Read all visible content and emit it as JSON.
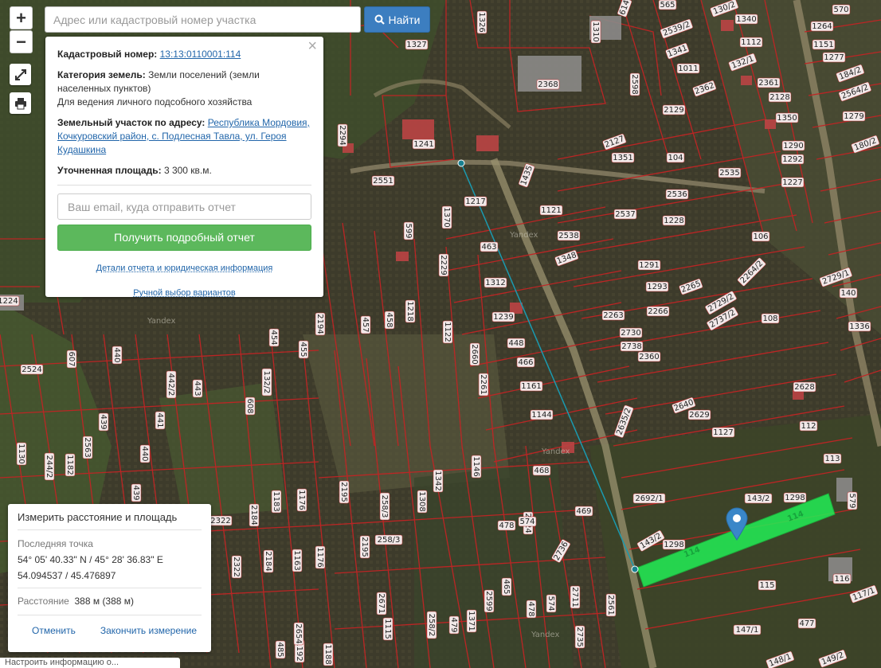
{
  "search": {
    "placeholder": "Адрес или кадастровый номер участка",
    "button_label": "Найти"
  },
  "map_controls": {
    "zoom_in": "+",
    "zoom_out": "−"
  },
  "popup": {
    "cadastral_label": "Кадастровый номер:",
    "cadastral_value": "13:13:0110001:114",
    "category_label": "Категория земель:",
    "category_value": "Земли поселений (земли населенных пунктов)",
    "usage": "Для ведения личного подсобного хозяйства",
    "address_label": "Земельный участок по адресу:",
    "address_value": "Республика Мордовия, Кочкуровский район, с. Подлесная Тавла, ул. Героя Кудашкина",
    "area_label": "Уточненная площадь:",
    "area_value": "3 300 кв.м.",
    "email_placeholder": "Ваш email, куда отправить отчет",
    "report_button": "Получить подробный отчет",
    "details_link": "Детали отчета и юридическая информация",
    "manual_link": "Ручной выбор вариантов"
  },
  "measure": {
    "title": "Измерить расстояние и площадь",
    "last_point_label": "Последняя точка",
    "dms": "54° 05' 40.33\" N / 45° 28' 36.83\" E",
    "decimal": "54.094537 / 45.476897",
    "distance_label": "Расстояние",
    "distance_value": "388 м (388 м)",
    "cancel": "Отменить",
    "finish": "Закончить измерение"
  },
  "bottom_bar": {
    "text": "Настроить информацию о..."
  },
  "map": {
    "selected_parcel_label": "114",
    "watermark": "Yandex",
    "parcel_labels": [
      "1326",
      "614",
      "565",
      "130/2",
      "1340",
      "570",
      "1264",
      "1310",
      "1327",
      "2539/2",
      "1112",
      "1151",
      "1341",
      "1277",
      "184/2",
      "1011",
      "132/1",
      "2368",
      "2362",
      "2361",
      "2564/2",
      "2598",
      "2129",
      "2128",
      "1350",
      "1279",
      "1241",
      "2127",
      "1290",
      "180/2",
      "1351",
      "104",
      "1292",
      "2294",
      "2535",
      "1227",
      "2551",
      "1435",
      "1217",
      "2536",
      "1370",
      "1121",
      "2537",
      "1228",
      "599",
      "2538",
      "106",
      "463",
      "1348",
      "1291",
      "2264/2",
      "2729/1",
      "1312",
      "1293",
      "2265",
      "140",
      "2229",
      "2263",
      "2729/2",
      "1218",
      "2266",
      "2737/2",
      "108",
      "1336",
      "1239",
      "457",
      "458",
      "2730",
      "454",
      "455",
      "2194",
      "1122",
      "448",
      "2738",
      "2360",
      "2660",
      "466",
      "2524",
      "607",
      "440",
      "442/2",
      "2261",
      "1161",
      "2628",
      "132/2",
      "443",
      "608",
      "1144",
      "2640",
      "2629",
      "112",
      "439",
      "441",
      "2563",
      "1127",
      "2635/2",
      "113",
      "1130",
      "244/2",
      "1182",
      "440",
      "1146",
      "468",
      "143/2",
      "1298",
      "579",
      "1342",
      "439",
      "2195",
      "1183",
      "1176",
      "258/3",
      "1308",
      "2692/1",
      "2322",
      "2184",
      "2724",
      "478",
      "574",
      "469",
      "143/2",
      "1298",
      "116",
      "258/3",
      "2736",
      "117/1",
      "1163",
      "1176",
      "2195",
      "2322",
      "2184",
      "465",
      "115",
      "2671",
      "258/2",
      "479",
      "1371",
      "2599",
      "478",
      "574",
      "2711",
      "2561",
      "147/1",
      "1115",
      "477",
      "485",
      "1192",
      "1188",
      "2654",
      "2735",
      "148/1",
      "149/2",
      "1224"
    ]
  }
}
